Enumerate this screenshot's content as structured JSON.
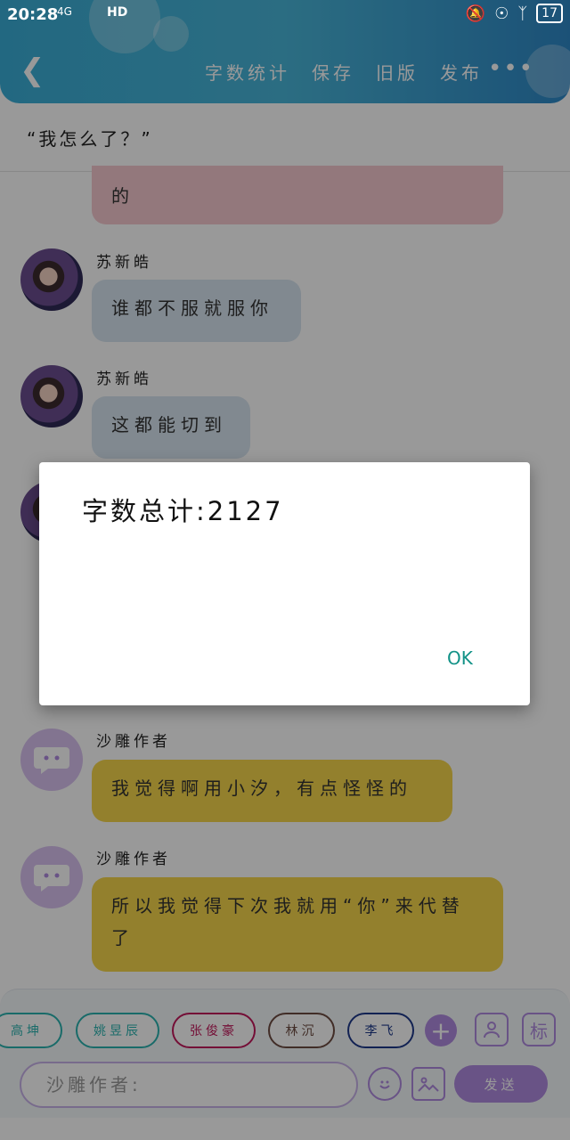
{
  "status_bar": {
    "time": "20:28",
    "signal": "4G",
    "network": "HD",
    "battery": "17"
  },
  "header": {
    "actions": [
      "字数统计",
      "保存",
      "旧版",
      "发布"
    ],
    "more": "•••"
  },
  "chat_title": "“我怎么了？”",
  "messages": [
    {
      "name": "",
      "text": "的",
      "color": "pink"
    },
    {
      "name": "苏新皓",
      "text": "谁都不服就服你",
      "color": "blue"
    },
    {
      "name": "苏新皓",
      "text": "这都能切到",
      "color": "blue"
    },
    {
      "name": "沙雕作者",
      "text": "我觉得啊用小汐，有点怪怪的",
      "color": "yellow"
    },
    {
      "name": "沙雕作者",
      "text": "所以我觉得下次我就用“你”来代替了",
      "color": "yellow"
    }
  ],
  "chips": [
    {
      "label": "高坤",
      "color": "#2bb3b0"
    },
    {
      "label": "姚昱辰",
      "color": "#2bb3b0"
    },
    {
      "label": "张俊豪",
      "color": "#c2185b"
    },
    {
      "label": "林沉",
      "color": "#6d4c41"
    },
    {
      "label": "李飞",
      "color": "#1e3a8a"
    }
  ],
  "input": {
    "placeholder": "沙雕作者:"
  },
  "send_label": "发送",
  "dialog": {
    "title": "字数总计:2127",
    "ok_label": "OK"
  },
  "colors": {
    "accent_purple": "#b08ae0",
    "header_blue": "#3aaed8",
    "ok_teal": "#129287"
  }
}
